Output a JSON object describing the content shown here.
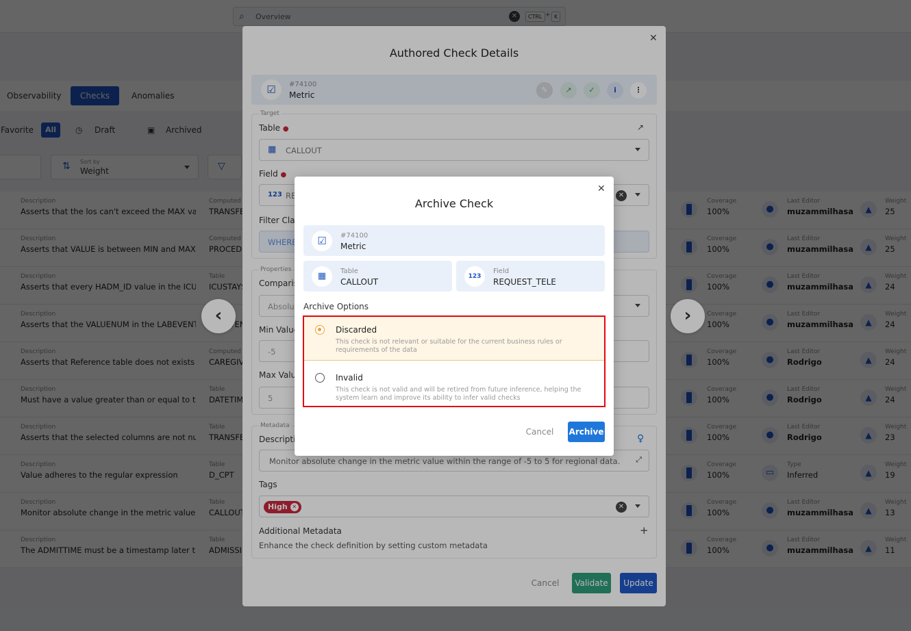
{
  "search": {
    "placeholder": "Overview",
    "kbd_ctrl": "CTRL",
    "kbd_plus": "+",
    "kbd_k": "K"
  },
  "tabs": [
    {
      "label": "Observability"
    },
    {
      "label": "Checks"
    },
    {
      "label": "Anomalies"
    }
  ],
  "filters": {
    "favorite": "Favorite",
    "all": "All",
    "draft": "Draft",
    "archived": "Archived"
  },
  "sort": {
    "label": "Sort by",
    "value": "Weight"
  },
  "rows": [
    {
      "desc": "Asserts that the los can't exceed the MAX valu...",
      "col2_label": "Computed",
      "col2": "TRANSFE",
      "editor_label": "Last Editor",
      "editor": "muzammilhasa...",
      "weight": "25"
    },
    {
      "desc": "Asserts that VALUE is between MIN and MAX",
      "col2_label": "Computed",
      "col2": "PROCEDU",
      "editor_label": "Last Editor",
      "editor": "muzammilhasa...",
      "weight": "25"
    },
    {
      "desc": "Asserts that every HADM_ID value in the ICUS...",
      "col2_label": "Table",
      "col2": "ICUSTAYS",
      "editor_label": "Last Editor",
      "editor": "muzammilhasa...",
      "weight": "24"
    },
    {
      "desc": "Asserts that the VALUENUM in the LABEVENTS...",
      "col2_label": "Table",
      "col2": "LABEVEN",
      "editor_label": "Last Editor",
      "editor": "muzammilhasa...",
      "weight": "24"
    },
    {
      "desc": "Asserts that Reference table does not exists i...",
      "col2_label": "Computed",
      "col2": "CAREGIV",
      "editor_label": "Last Editor",
      "editor": "Rodrigo",
      "weight": "24"
    },
    {
      "desc": "Must have a value greater than or equal to the ...",
      "col2_label": "Table",
      "col2": "DATETIM",
      "editor_label": "Last Editor",
      "editor": "Rodrigo",
      "weight": "24"
    },
    {
      "desc": "Asserts that the selected columns are not null",
      "col2_label": "Table",
      "col2": "TRANSFE",
      "editor_label": "Last Editor",
      "editor": "Rodrigo",
      "weight": "23"
    },
    {
      "desc": "Value adheres to the regular expression",
      "col2_label": "Table",
      "col2": "D_CPT",
      "editor_label": "Type",
      "editor": "Inferred",
      "weight": "19"
    },
    {
      "desc": "Monitor absolute change in the metric value w...",
      "col2_label": "Table",
      "col2": "CALLOUT",
      "editor_label": "Last Editor",
      "editor": "muzammilhasa...",
      "weight": "13"
    },
    {
      "desc": "The ADMITTIME must be a timestamp later tha...",
      "col2_label": "Table",
      "col2": "ADMISSI",
      "editor_label": "Last Editor",
      "editor": "muzammilhasa...",
      "weight": "11"
    }
  ],
  "row_labels": {
    "description": "Description",
    "coverage": "Coverage",
    "coverage_value": "100%",
    "weight": "Weight"
  },
  "authored": {
    "title": "Authored Check Details",
    "check_id": "#74100",
    "check_type": "Metric",
    "target_title": "Target",
    "table_label": "Table",
    "table_value": "CALLOUT",
    "field_label": "Field",
    "field_value": "RE",
    "filter_label": "Filter Clau",
    "filter_placeholder": "WHERE",
    "properties_title": "Properties",
    "comparison_label": "Comparis",
    "comparison_value": "Absolut",
    "min_label": "Min Value",
    "min_value": "-5",
    "max_label": "Max Valu",
    "max_value": "5",
    "metadata_title": "Metadata",
    "description_label": "Descripti",
    "description_value": "Monitor absolute change in the metric value within the range of -5 to 5 for regional data.",
    "tags_label": "Tags",
    "tag": "High",
    "additional_label": "Additional Metadata",
    "additional_desc": "Enhance the check definition by setting custom metadata",
    "cancel": "Cancel",
    "validate": "Validate",
    "update": "Update"
  },
  "archive": {
    "title": "Archive Check",
    "check_id": "#74100",
    "check_type": "Metric",
    "table_label": "Table",
    "table_value": "CALLOUT",
    "field_label": "Field",
    "field_value": "REQUEST_TELE",
    "options_label": "Archive Options",
    "options": [
      {
        "title": "Discarded",
        "desc": "This check is not relevant or suitable for the current business rules or requirements of the data",
        "selected": true
      },
      {
        "title": "Invalid",
        "desc": "This check is not valid and will be retired from future inference, helping the system learn and improve its ability to infer valid checks",
        "selected": false
      }
    ],
    "cancel": "Cancel",
    "archive": "Archive"
  },
  "colors": {
    "accent": "#1f57c4",
    "button": "#1f78d9",
    "green": "#2e9a78",
    "highlight": "#e30613",
    "selected_bg": "#fff6e5",
    "tag": "#c6283c"
  }
}
